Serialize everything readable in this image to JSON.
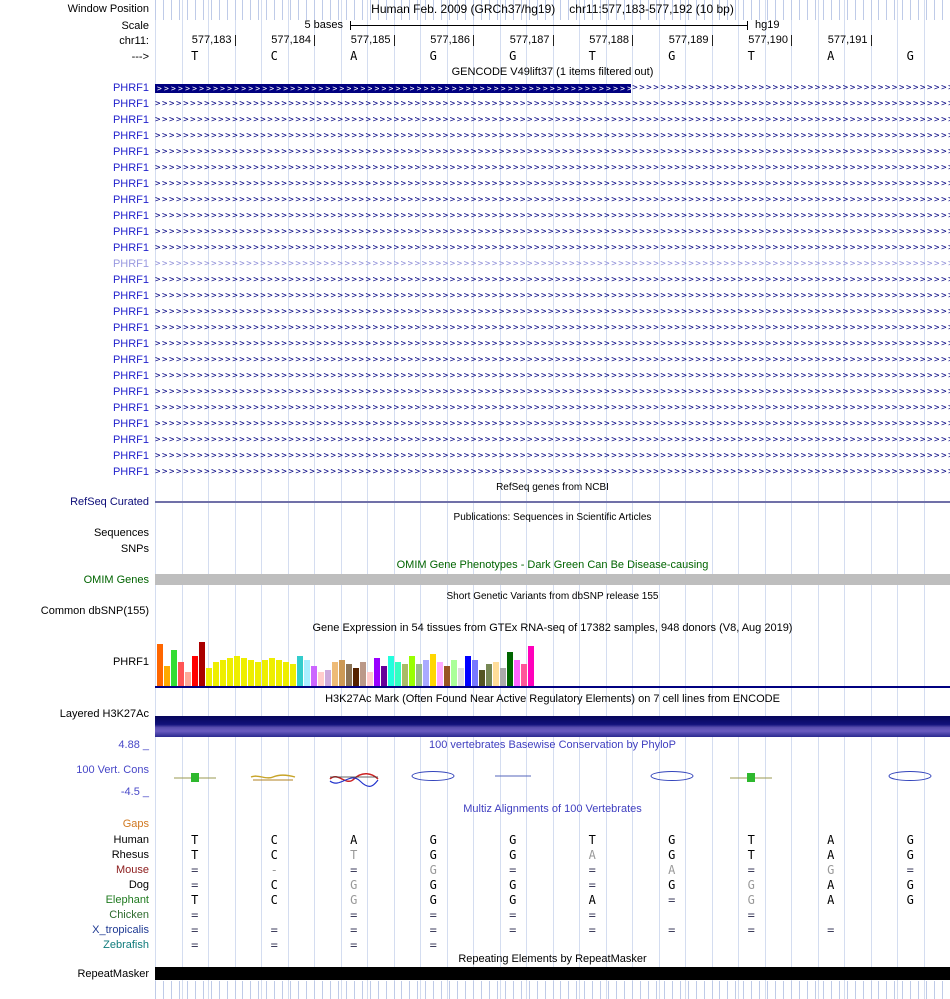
{
  "header": {
    "window_position_label": "Window Position",
    "assembly_title": "Human Feb. 2009 (GRCh37/hg19)",
    "position_title": "chr11:577,183-577,192 (10 bp)",
    "scale_label": "Scale",
    "scale_value": "5 bases",
    "assembly_short": "hg19",
    "chrom_label": "chr11:",
    "strand_label": "--->",
    "coordinates": [
      "577,183",
      "577,184",
      "577,185",
      "577,186",
      "577,187",
      "577,188",
      "577,189",
      "577,190",
      "577,191"
    ],
    "bases": [
      "T",
      "C",
      "A",
      "G",
      "G",
      "T",
      "G",
      "T",
      "A",
      "G"
    ]
  },
  "gencode": {
    "header": "GENCODE V49lift37 (1 items filtered out)",
    "gene_label": "PHRF1",
    "rows": 25,
    "light_row_index": 11,
    "exon_color": "#000080",
    "light_color": "#8f8fd8",
    "label_color": "#2222cc",
    "label_light_color": "#9a9ae0"
  },
  "refseq": {
    "header": "RefSeq genes from NCBI",
    "label": "RefSeq Curated",
    "label_color": "#0c0c78"
  },
  "publications": {
    "header": "Publications: Sequences in Scientific Articles",
    "sequences_label": "Sequences",
    "snps_label": "SNPs"
  },
  "omim": {
    "header": "OMIM Gene Phenotypes - Dark Green Can Be Disease-causing",
    "label": "OMIM Genes",
    "color": "#006400",
    "bar_color": "#bebebe"
  },
  "dbsnp": {
    "header": "Short Genetic Variants from dbSNP release 155",
    "label": "Common dbSNP(155)"
  },
  "gtex": {
    "header": "Gene Expression in 54 tissues from GTEx RNA-seq of 17382 samples, 948 donors (V8, Aug 2019)",
    "label": "PHRF1",
    "baseline_color": "#000080",
    "chart_data": {
      "type": "bar",
      "title": "GTEx PHRF1 expression across 54 tissues",
      "values": [
        42,
        20,
        36,
        24,
        14,
        30,
        44,
        18,
        24,
        26,
        28,
        30,
        28,
        26,
        24,
        26,
        28,
        26,
        24,
        22,
        30,
        26,
        20,
        14,
        16,
        24,
        26,
        22,
        18,
        24,
        14,
        28,
        20,
        30,
        24,
        22,
        30,
        22,
        26,
        32,
        24,
        20,
        26,
        18,
        30,
        26,
        16,
        22,
        24,
        18,
        34,
        26,
        22,
        40
      ],
      "colors": [
        "#FF6600",
        "#FFAA00",
        "#33DD33",
        "#FF5555",
        "#FFAA99",
        "#FF0000",
        "#AA0000",
        "#EEEE00",
        "#EEEE00",
        "#EEEE00",
        "#EEEE00",
        "#EEEE00",
        "#EEEE00",
        "#EEEE00",
        "#EEEE00",
        "#EEEE00",
        "#EEEE00",
        "#EEEE00",
        "#EEEE00",
        "#EEEE00",
        "#33CCCC",
        "#AAEEFF",
        "#CC66FF",
        "#FFCCCC",
        "#CCAADD",
        "#EEBB77",
        "#CC9955",
        "#8B7355",
        "#552200",
        "#BB9988",
        "#FFCCCC",
        "#9900FF",
        "#660099",
        "#22FFDD",
        "#33FFC2",
        "#AABB66",
        "#99FF00",
        "#99BB88",
        "#AAAAFF",
        "#FFD700",
        "#FFAAFF",
        "#995522",
        "#AAFF99",
        "#DDDDDD",
        "#0000FF",
        "#7777FF",
        "#555522",
        "#778855",
        "#FFDD99",
        "#AAAAAA",
        "#006600",
        "#FF66FF",
        "#FF5599",
        "#FF00BB"
      ]
    }
  },
  "h3k27ac": {
    "header": "H3K27Ac Mark (Often Found Near Active Regulatory Elements) on 7 cell lines from ENCODE",
    "label": "Layered H3K27Ac"
  },
  "phylop": {
    "header": "100 vertebrates Basewise Conservation by PhyloP",
    "label": "100 Vert. Cons",
    "max_label": "4.88 _",
    "min_label": "-4.5 _",
    "color": "#4848c8",
    "marks": [
      {
        "col": 1,
        "type": "green-box"
      },
      {
        "col": 2,
        "type": "orange-squiggle"
      },
      {
        "col": 3,
        "type": "red-blue-squiggle"
      },
      {
        "col": 4,
        "type": "blue-ellipse"
      },
      {
        "col": 5,
        "type": "blue-line"
      },
      {
        "col": 7,
        "type": "blue-ellipse"
      },
      {
        "col": 8,
        "type": "green-box"
      },
      {
        "col": 10,
        "type": "blue-ellipse"
      }
    ]
  },
  "multiz": {
    "header": "Multiz Alignments of 100 Vertebrates",
    "header_color": "#4040c0",
    "gaps_label": "Gaps",
    "gaps_color": "#d07820",
    "species": [
      {
        "name": "Human",
        "color": "#000000",
        "cells": [
          {
            "t": "T",
            "c": "#000000"
          },
          {
            "t": "C",
            "c": "#000000"
          },
          {
            "t": "A",
            "c": "#000000"
          },
          {
            "t": "G",
            "c": "#000000"
          },
          {
            "t": "G",
            "c": "#000000"
          },
          {
            "t": "T",
            "c": "#000000"
          },
          {
            "t": "G",
            "c": "#000000"
          },
          {
            "t": "T",
            "c": "#000000"
          },
          {
            "t": "A",
            "c": "#000000"
          },
          {
            "t": "G",
            "c": "#000000"
          }
        ]
      },
      {
        "name": "Rhesus",
        "color": "#000000",
        "cells": [
          {
            "t": "T",
            "c": "#000000"
          },
          {
            "t": "C",
            "c": "#000000"
          },
          {
            "t": "T",
            "c": "#999999"
          },
          {
            "t": "G",
            "c": "#000000"
          },
          {
            "t": "G",
            "c": "#000000"
          },
          {
            "t": "A",
            "c": "#999999"
          },
          {
            "t": "G",
            "c": "#000000"
          },
          {
            "t": "T",
            "c": "#000000"
          },
          {
            "t": "A",
            "c": "#000000"
          },
          {
            "t": "G",
            "c": "#000000"
          }
        ]
      },
      {
        "name": "Mouse",
        "color": "#8b1a1a",
        "cells": [
          {
            "t": "=",
            "c": "#3d3d5c"
          },
          {
            "t": "-",
            "c": "#999999"
          },
          {
            "t": "=",
            "c": "#3d3d5c"
          },
          {
            "t": "G",
            "c": "#999999"
          },
          {
            "t": "=",
            "c": "#3d3d5c"
          },
          {
            "t": "=",
            "c": "#3d3d5c"
          },
          {
            "t": "A",
            "c": "#999999"
          },
          {
            "t": "=",
            "c": "#3d3d5c"
          },
          {
            "t": "G",
            "c": "#999999"
          },
          {
            "t": "=",
            "c": "#3d3d5c"
          }
        ]
      },
      {
        "name": "Dog",
        "color": "#000000",
        "cells": [
          {
            "t": "=",
            "c": "#3d3d5c"
          },
          {
            "t": "C",
            "c": "#000000"
          },
          {
            "t": "G",
            "c": "#999999"
          },
          {
            "t": "G",
            "c": "#000000"
          },
          {
            "t": "G",
            "c": "#000000"
          },
          {
            "t": "=",
            "c": "#3d3d5c"
          },
          {
            "t": "G",
            "c": "#000000"
          },
          {
            "t": "G",
            "c": "#999999"
          },
          {
            "t": "A",
            "c": "#000000"
          },
          {
            "t": "G",
            "c": "#000000"
          }
        ]
      },
      {
        "name": "Elephant",
        "color": "#1f7a1f",
        "cells": [
          {
            "t": "T",
            "c": "#000000"
          },
          {
            "t": "C",
            "c": "#000000"
          },
          {
            "t": "G",
            "c": "#999999"
          },
          {
            "t": "G",
            "c": "#000000"
          },
          {
            "t": "G",
            "c": "#000000"
          },
          {
            "t": "A",
            "c": "#000000"
          },
          {
            "t": "=",
            "c": "#3d3d5c"
          },
          {
            "t": "G",
            "c": "#999999"
          },
          {
            "t": "A",
            "c": "#000000"
          },
          {
            "t": "G",
            "c": "#000000"
          }
        ]
      },
      {
        "name": "Chicken",
        "color": "#2e6b2e",
        "cells": [
          {
            "t": "=",
            "c": "#3d3d5c"
          },
          {
            "t": ""
          },
          {
            "t": "=",
            "c": "#3d3d5c"
          },
          {
            "t": "=",
            "c": "#3d3d5c"
          },
          {
            "t": "=",
            "c": "#3d3d5c"
          },
          {
            "t": "=",
            "c": "#3d3d5c"
          },
          {
            "t": ""
          },
          {
            "t": "=",
            "c": "#3d3d5c"
          },
          {
            "t": ""
          },
          {
            "t": ""
          }
        ]
      },
      {
        "name": "X_tropicalis",
        "color": "#1f3a93",
        "cells": [
          {
            "t": "=",
            "c": "#3d3d5c"
          },
          {
            "t": "=",
            "c": "#3d3d5c"
          },
          {
            "t": "=",
            "c": "#3d3d5c"
          },
          {
            "t": "=",
            "c": "#3d3d5c"
          },
          {
            "t": "=",
            "c": "#3d3d5c"
          },
          {
            "t": "=",
            "c": "#3d3d5c"
          },
          {
            "t": "=",
            "c": "#3d3d5c"
          },
          {
            "t": "=",
            "c": "#3d3d5c"
          },
          {
            "t": "=",
            "c": "#3d3d5c"
          },
          {
            "t": ""
          }
        ]
      },
      {
        "name": "Zebrafish",
        "color": "#0f7b7b",
        "cells": [
          {
            "t": "=",
            "c": "#3d3d5c"
          },
          {
            "t": "=",
            "c": "#3d3d5c"
          },
          {
            "t": "=",
            "c": "#3d3d5c"
          },
          {
            "t": "=",
            "c": "#3d3d5c"
          },
          {
            "t": ""
          },
          {
            "t": ""
          },
          {
            "t": ""
          },
          {
            "t": ""
          },
          {
            "t": ""
          },
          {
            "t": ""
          }
        ]
      }
    ]
  },
  "repeat": {
    "header": "Repeating Elements by RepeatMasker",
    "label": "RepeatMasker"
  }
}
